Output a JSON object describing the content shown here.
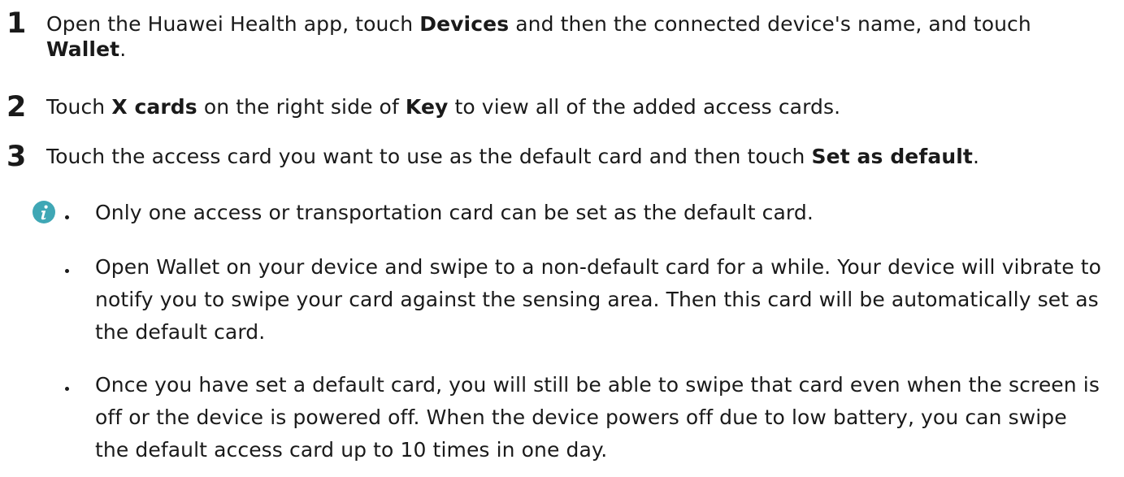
{
  "steps": [
    {
      "number": "1",
      "parts": [
        {
          "t": "Open the Huawei Health app, touch ",
          "b": false
        },
        {
          "t": "Devices",
          "b": true
        },
        {
          "t": " and then the connected device's name, and touch ",
          "b": false
        },
        {
          "t": "Wallet",
          "b": true
        },
        {
          "t": ".",
          "b": false
        }
      ]
    },
    {
      "number": "2",
      "parts": [
        {
          "t": "Touch ",
          "b": false
        },
        {
          "t": "X cards",
          "b": true
        },
        {
          "t": " on the right side of ",
          "b": false
        },
        {
          "t": "Key",
          "b": true
        },
        {
          "t": " to view all of the added access cards.",
          "b": false
        }
      ]
    },
    {
      "number": "3",
      "parts": [
        {
          "t": "Touch the access card you want to use as the default card and then touch ",
          "b": false
        },
        {
          "t": "Set as default",
          "b": true
        },
        {
          "t": ".",
          "b": false
        }
      ]
    }
  ],
  "note": {
    "icon": "info-icon",
    "icon_color": "#3fa7b5",
    "bullets": [
      "Only one access or transportation card can be set as the default card.",
      "Open Wallet on your device and swipe to a non-default card for a while. Your device will vibrate to notify you to swipe your card against the sensing area. Then this card will be automatically set as the default card.",
      "Once you have set a default card, you will still be able to swipe that card even when the screen is off or the device is powered off. When the device powers off due to low battery, you can swipe the default access card up to 10 times in one day."
    ]
  }
}
